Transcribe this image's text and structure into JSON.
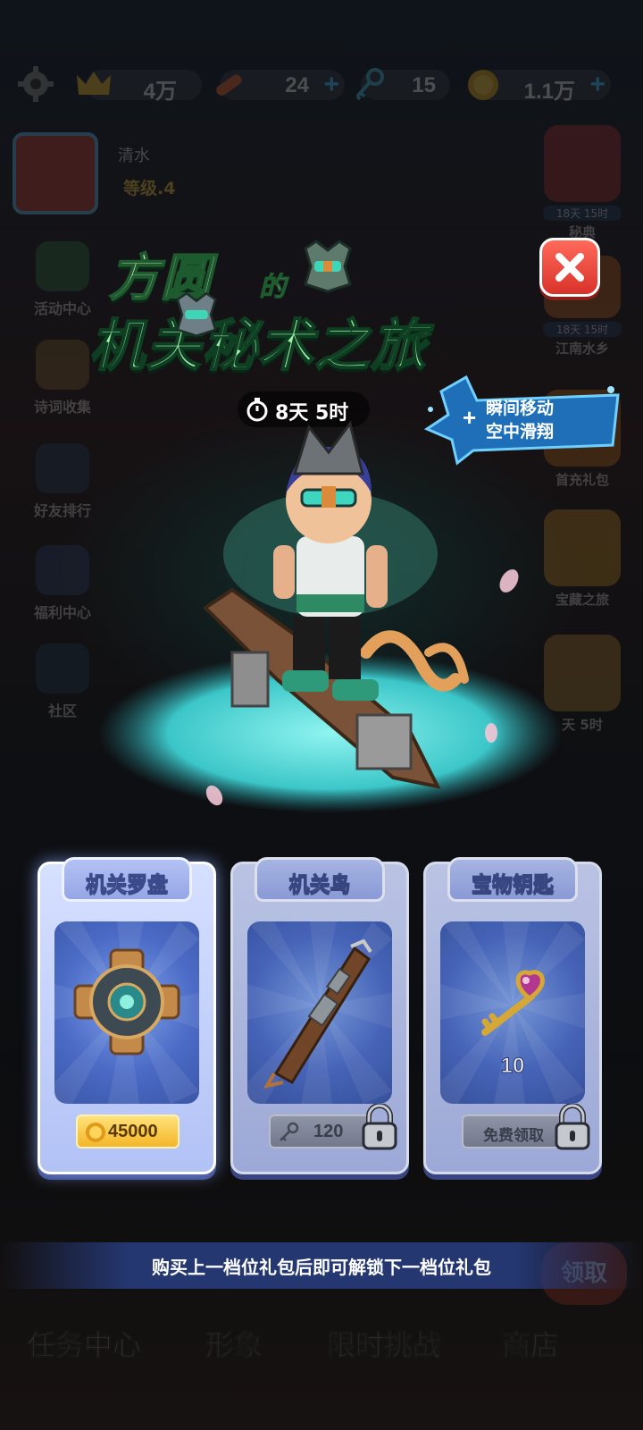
{
  "topbar": {
    "crowns": "4万",
    "boards": "24",
    "keys": "15",
    "coins": "1.1万"
  },
  "profile": {
    "name": "清水",
    "level": "等级.4"
  },
  "left_sidebar": [
    "活动中心",
    "诗词收集",
    "好友排行",
    "福利中心",
    "社区"
  ],
  "right_sidebar": [
    {
      "timer": "18天 15时",
      "label": "秘典"
    },
    {
      "timer": "18天 15时",
      "label": "江南水乡"
    },
    {
      "timer": "",
      "label": "首充礼包"
    },
    {
      "timer": "",
      "label": "宝藏之旅"
    },
    {
      "timer": "",
      "label": "天 5时"
    }
  ],
  "bottom_nav": [
    "任务中心",
    "形象",
    "限时挑战",
    "商店"
  ],
  "bottom_claim": "领取",
  "popup": {
    "title_line1": "方圆",
    "title_de": "的",
    "title_line2": "机关秘术之旅",
    "timer": "8天 5时",
    "perk_line1": "瞬间移动",
    "perk_line2": "空中滑翔",
    "cards": [
      {
        "title": "机关罗盘",
        "price_value": "45000",
        "price_type": "coin",
        "locked": false,
        "qty": ""
      },
      {
        "title": "机关鸟",
        "price_value": "120",
        "price_type": "key",
        "locked": true,
        "qty": ""
      },
      {
        "title": "宝物钥匙",
        "price_text": "免费领取",
        "price_type": "free",
        "locked": true,
        "qty": "10"
      }
    ],
    "hint": "购买上一档位礼包后即可解锁下一档位礼包"
  },
  "colors": {
    "accent_green": "#9ff0a8",
    "close_red": "#e0392f",
    "card_blue": "#b2c2f5",
    "coin_gold": "#f4b628"
  }
}
